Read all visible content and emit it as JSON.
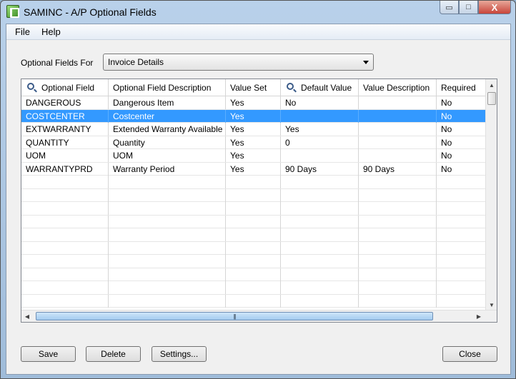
{
  "window": {
    "title": "SAMINC - A/P Optional Fields",
    "minimize_glyph": "▭",
    "maximize_glyph": "□",
    "close_glyph": "X"
  },
  "menu": [
    "File",
    "Help"
  ],
  "optional_fields_for": {
    "label": "Optional Fields For",
    "selected": "Invoice Details"
  },
  "grid": {
    "columns": [
      {
        "label": "Optional Field",
        "icon": "search-icon"
      },
      {
        "label": "Optional Field Description"
      },
      {
        "label": "Value Set"
      },
      {
        "label": "Default Value",
        "icon": "search-icon"
      },
      {
        "label": "Value Description"
      },
      {
        "label": "Required"
      }
    ],
    "rows": [
      {
        "field": "DANGEROUS",
        "description": "Dangerous Item",
        "value_set": "Yes",
        "default_value": "No",
        "value_description": "",
        "required": "No"
      },
      {
        "field": "COSTCENTER",
        "description": "Costcenter",
        "value_set": "Yes",
        "default_value": "",
        "value_description": "",
        "required": "No"
      },
      {
        "field": "EXTWARRANTY",
        "description": "Extended Warranty Available",
        "value_set": "Yes",
        "default_value": "Yes",
        "value_description": "",
        "required": "No"
      },
      {
        "field": "QUANTITY",
        "description": "Quantity",
        "value_set": "Yes",
        "default_value": "0",
        "value_description": "",
        "required": "No"
      },
      {
        "field": "UOM",
        "description": "UOM",
        "value_set": "Yes",
        "default_value": "",
        "value_description": "",
        "required": "No"
      },
      {
        "field": "WARRANTYPRD",
        "description": "Warranty Period",
        "value_set": "Yes",
        "default_value": "90 Days",
        "value_description": "90 Days",
        "required": "No"
      }
    ],
    "selected_row": 1,
    "scroll_up_glyph": "▲",
    "scroll_down_glyph": "▼",
    "scroll_left_glyph": "◀",
    "scroll_right_glyph": "▶",
    "thumb_grip": "|||"
  },
  "buttons": {
    "save": "Save",
    "delete": "Delete",
    "settings": "Settings...",
    "close": "Close"
  },
  "colors": {
    "selection": "#3399ff"
  }
}
